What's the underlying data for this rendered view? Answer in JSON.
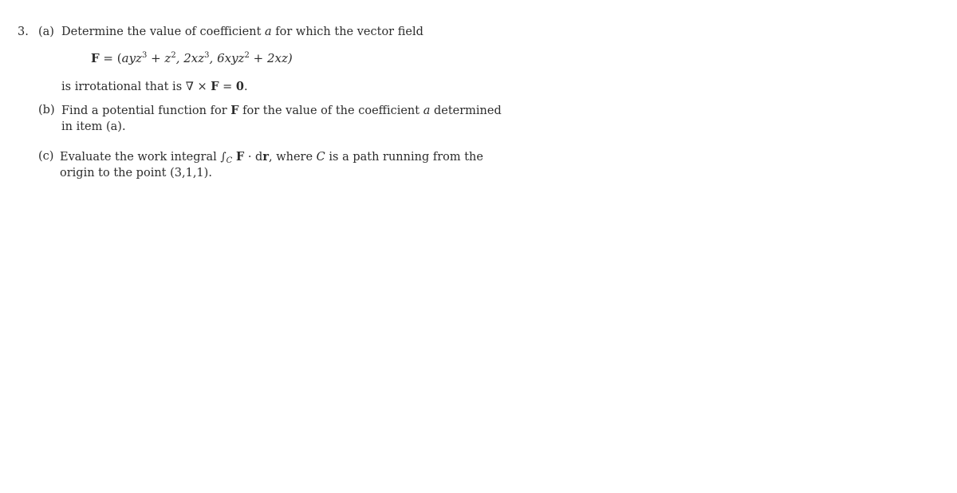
{
  "problem": {
    "number": "3.",
    "part_a": {
      "label": "(a)",
      "text_before": "Determine the value of coefficient ",
      "variable": "a",
      "text_after": " for which the vector field",
      "formula": {
        "lhs": "F",
        "equals": " = (",
        "c1": "ayz",
        "c1_exp": "3",
        "c1b": " + z",
        "c1b_exp": "2",
        "c2": ", 2xz",
        "c2_exp": "3",
        "c3": ", 6xyz",
        "c3_exp": "2",
        "c3b": " + 2xz)"
      },
      "conclusion_before": "is irrotational that is ∇ × ",
      "conclusion_bold_F": "F",
      "conclusion_eq": " = ",
      "conclusion_bold_zero": "0",
      "conclusion_end": "."
    },
    "part_b": {
      "label": "(b)",
      "line1_before": "Find a potential function for ",
      "bold_F": "F",
      "line1_mid": " for the value of the coefficient ",
      "variable": "a",
      "line1_after": " determined",
      "line2": "in item (a)."
    },
    "part_c": {
      "label": "(c)",
      "line1_before": "Evaluate the work integral ",
      "integral_sign": "∫",
      "integral_sub": "C",
      "bold_F": "F",
      "dot": " · d",
      "bold_r": "r",
      "line1_mid": ", where ",
      "variable_C": "C",
      "line1_after": " is a path running from the",
      "line2": "origin to the point (3,1,1)."
    }
  }
}
